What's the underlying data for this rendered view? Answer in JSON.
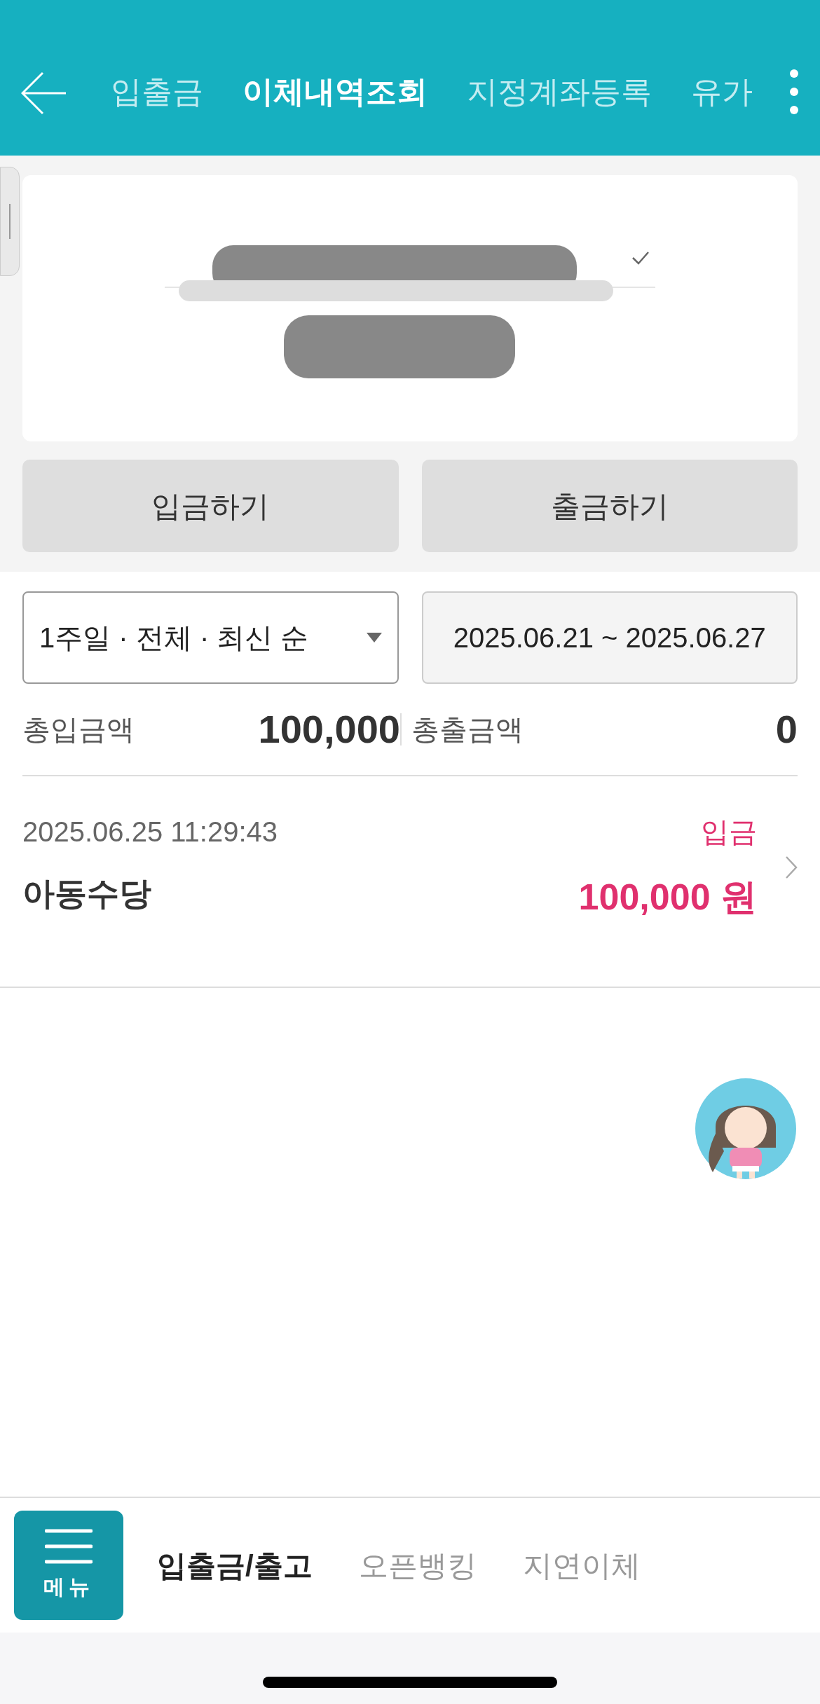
{
  "header": {
    "tabs": [
      {
        "label": "입출금",
        "selected": false
      },
      {
        "label": "이체내역조회",
        "selected": true
      },
      {
        "label": "지정계좌등록",
        "selected": false
      },
      {
        "label": "유가",
        "selected": false
      }
    ]
  },
  "actions": [
    "입금하기",
    "출금하기"
  ],
  "filter": {
    "value": "1주일 · 전체 · 최신 순"
  },
  "date_range": {
    "value": "2025.06.21 ~ 2025.06.27"
  },
  "totals": [
    {
      "label": "총입금액",
      "amount": "100,000"
    },
    {
      "label": "총출금액",
      "amount": "0"
    }
  ],
  "transactions": [
    {
      "datetime": "2025.06.25 11:29:43",
      "kind": "deposit",
      "type": "입금",
      "name": "아동수당",
      "amount": "100,000 원"
    }
  ],
  "bottom_nav": {
    "menu_label": "메뉴",
    "tabs": [
      {
        "label": "입출금/출고",
        "selected": true
      },
      {
        "label": "오픈뱅킹",
        "selected": false
      },
      {
        "label": "지연이체",
        "selected": false
      }
    ]
  }
}
